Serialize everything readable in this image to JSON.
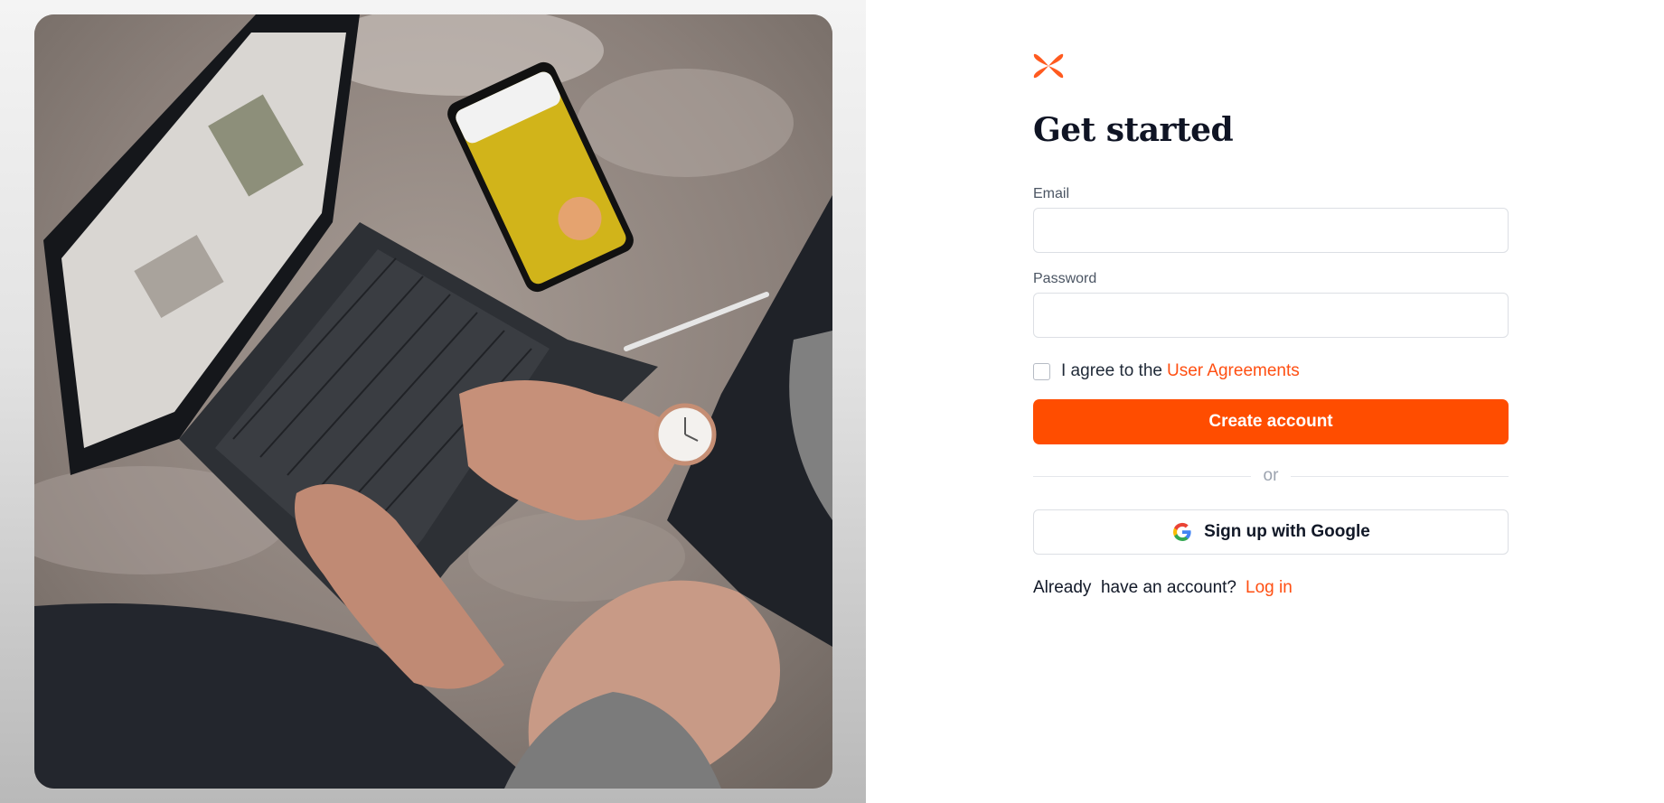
{
  "form": {
    "title": "Get started",
    "email_label": "Email",
    "email_value": "",
    "password_label": "Password",
    "password_value": "",
    "agree_text": "I agree to the",
    "agree_link": "User Agreements",
    "agree_checked": false,
    "create_button": "Create account",
    "divider_text": "or",
    "google_button": "Sign up with Google",
    "login_prompt": "Already  have an account?",
    "login_link": "Log in"
  },
  "icons": {
    "logo": "brand-flower-icon",
    "google": "google-icon"
  },
  "colors": {
    "accent": "#ff4d00",
    "link": "#ff4f12",
    "title": "#0f1424"
  }
}
